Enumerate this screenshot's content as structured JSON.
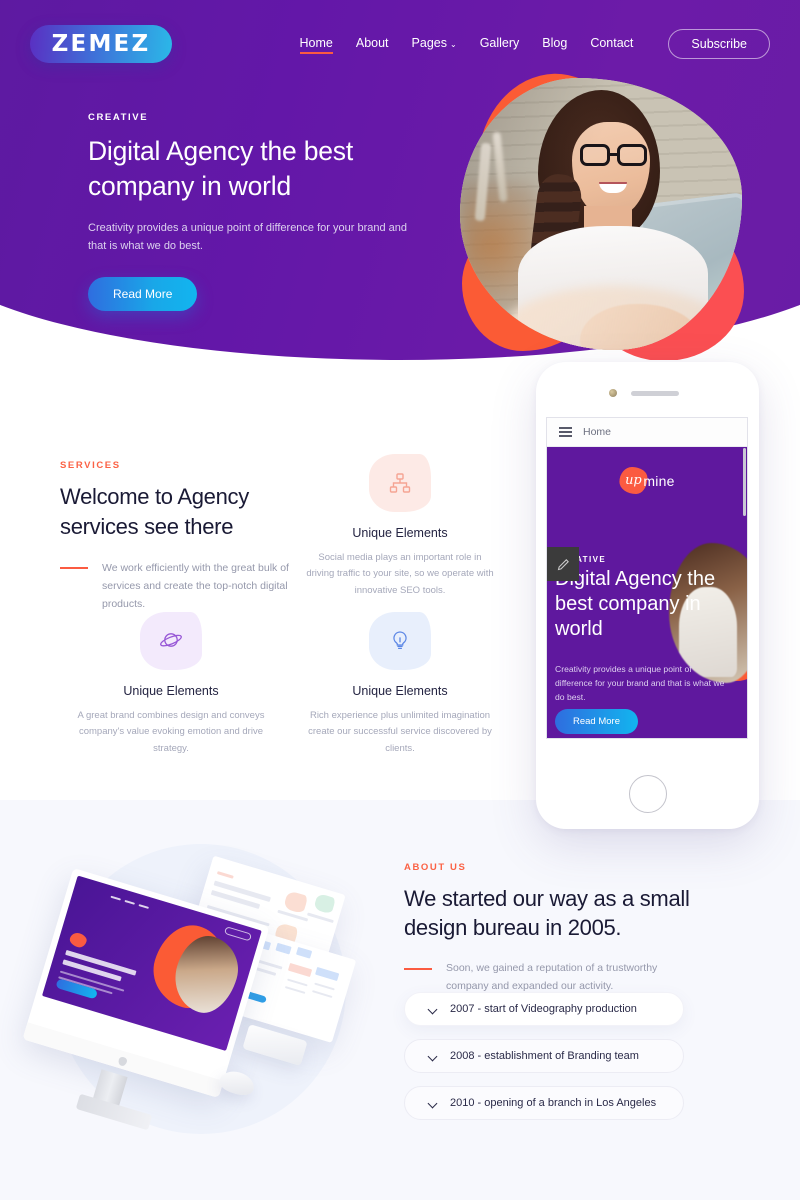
{
  "header": {
    "logo_text": "ZEMEZ",
    "nav": [
      {
        "label": "Home",
        "active": true
      },
      {
        "label": "About",
        "active": false
      },
      {
        "label": "Pages",
        "active": false,
        "caret": "⌄"
      },
      {
        "label": "Gallery",
        "active": false
      },
      {
        "label": "Blog",
        "active": false
      },
      {
        "label": "Contact",
        "active": false
      }
    ],
    "subscribe_label": "Subscribe"
  },
  "hero": {
    "eyebrow": "CREATIVE",
    "title": "Digital Agency the best company in world",
    "subtitle": "Creativity provides a unique point of difference for your brand and that is what we do best.",
    "cta_label": "Read More"
  },
  "services": {
    "eyebrow": "SERVICES",
    "title": "Welcome to Agency services see there",
    "description": "We work efficiently with the great bulk of services and create the top-notch digital products.",
    "cards": [
      {
        "icon": "sitemap-icon",
        "title": "Unique Elements",
        "text": "Social media plays an important role in driving traffic to your site, so we operate with innovative SEO tools."
      },
      {
        "icon": "planet-icon",
        "title": "Unique Elements",
        "text": "A great brand combines design and conveys company's value evoking emotion and drive strategy."
      },
      {
        "icon": "lightbulb-icon",
        "title": "Unique Elements",
        "text": "Rich experience plus unlimited imagination create our successful service discovered by clients."
      }
    ]
  },
  "phone_mockup": {
    "browser_label": "Home",
    "logo_mark": "up",
    "logo_text": "mine",
    "eyebrow": "CREATIVE",
    "title": "Digital Agency the best company in world",
    "subtitle": "Creativity provides a unique point of difference for your brand and that is what we do best.",
    "cta_label": "Read More"
  },
  "about": {
    "eyebrow": "ABOUT US",
    "title": "We started our way as a small design bureau in 2005.",
    "description": "Soon, we gained a reputation of a trustworthy company and expanded our activity.",
    "accordion": [
      {
        "label": "2007 - start of Videography production",
        "open": true
      },
      {
        "label": "2008 - establishment of Branding team",
        "open": false
      },
      {
        "label": "2010 - opening of a branch in Los Angeles",
        "open": false
      }
    ]
  },
  "colors": {
    "purple": "#5f189e",
    "orange": "#fb5b41",
    "blue_accent": "#12b5ef",
    "dark_text": "#1a1a35",
    "muted_text": "#9598ab",
    "about_bg": "#f7f8fd"
  }
}
